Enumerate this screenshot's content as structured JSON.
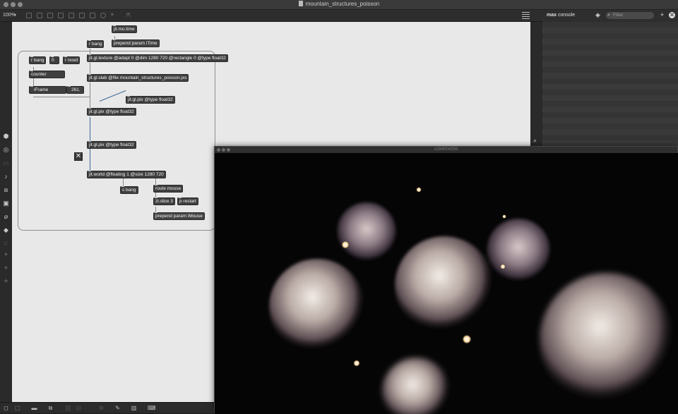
{
  "window": {
    "title": "mountain_structures_poisson"
  },
  "toolbar": {
    "zoom": "100%"
  },
  "console": {
    "title_bold": "max",
    "title_rest": " console",
    "filter_placeholder": "Filter"
  },
  "render_window": {
    "title": "u284004358"
  },
  "patch": {
    "objects": {
      "jit_mo_time": "jit.mo.time",
      "r_bang_top": "r bang",
      "prepend_itime": "prepend param iTime",
      "r_bang_left": "r bang",
      "number_0": "0",
      "r_reset": "r reset",
      "jit_gl_texture": "jit.gl.texture @adapt 0 @dim 1280 720 @rectangle 0 @type float32",
      "counter": "counter",
      "jit_gl_slab": "jit.gl.slab @file mountain_structures_poisson.jxs",
      "iframe_label": "iFrame",
      "iframe_value": "261.",
      "jit_gl_pix_a": "jit.gl.pix @type float32",
      "jit_gl_pix_b": "jit.gl.pix @type float32",
      "jit_gl_pix_c": "jit.gl.pix @type float32",
      "jit_world": "jit.world @floating 1 @size 1280 720",
      "s_bang": "s bang",
      "route_mouse": "route mouse",
      "zl_slice": "zl.slice 3",
      "p_restart": "p restart",
      "prepend_imouse": "prepend param iMouse"
    }
  },
  "colors": {
    "canvas": "#e8e8e8",
    "object": "#3f3f3f",
    "patchcord": "#8a8a8a",
    "jitter_cord": "#3d6a9b"
  }
}
